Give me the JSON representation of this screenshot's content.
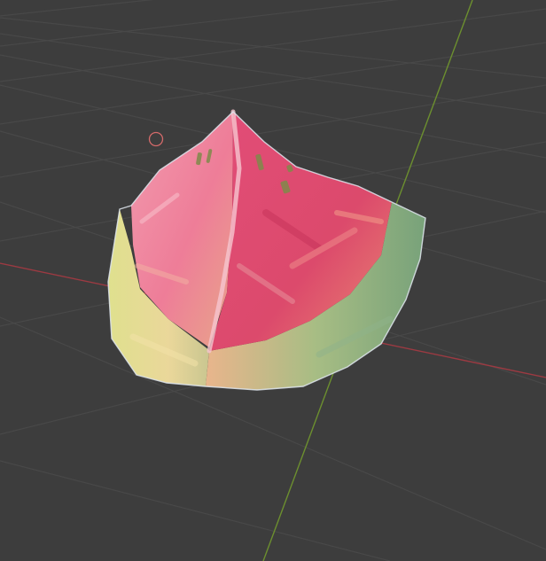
{
  "viewport": {
    "background_color": "#3d3d3d",
    "grid_line_color": "#484848",
    "x_axis_color": "#9c3a42",
    "y_axis_color": "#6c8f2f",
    "cursor_color": "#d46a6a",
    "cursor_icon": "3d-cursor-icon"
  },
  "object": {
    "subject": "watermelon-slice",
    "flesh_colors": [
      "#e44f78",
      "#f08aa0",
      "#d8395f"
    ],
    "rind_colors": [
      "#ecdf9a",
      "#9bbf7a",
      "#6f9c6a"
    ],
    "outline_color": "#dfe6ee"
  }
}
